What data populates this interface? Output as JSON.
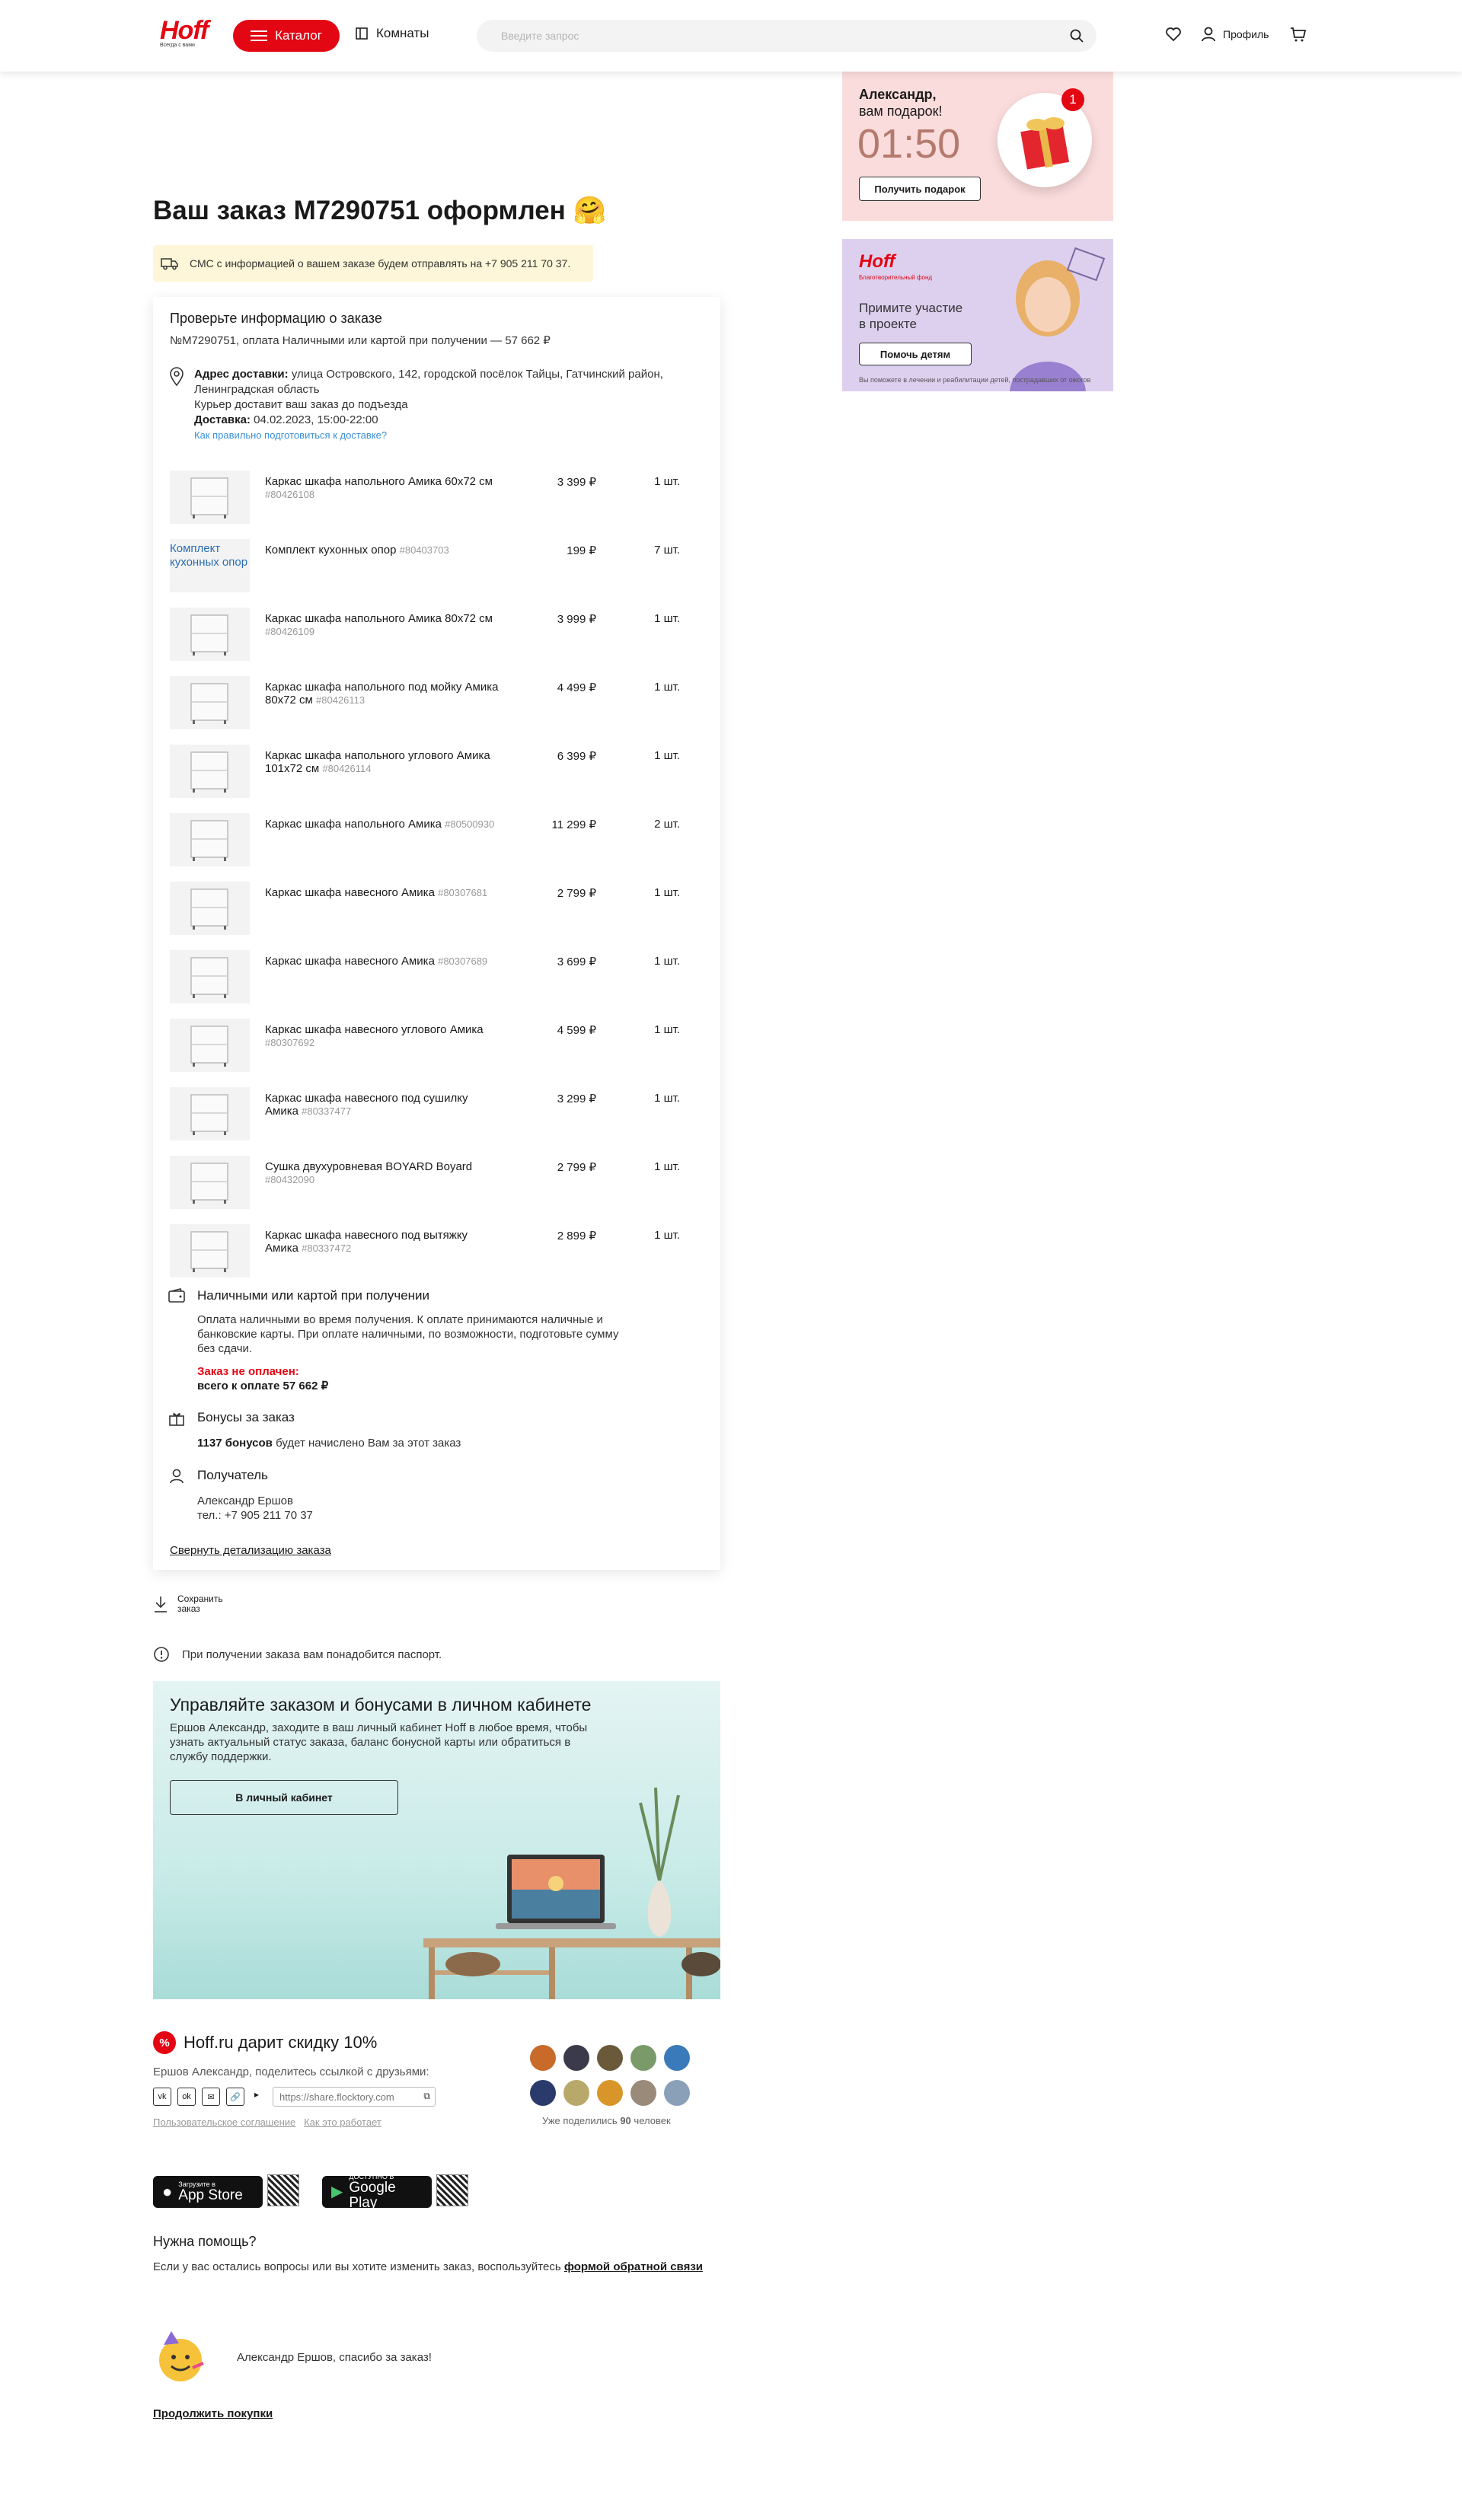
{
  "header": {
    "logo": "Hoff",
    "logo_sub": "Всегда с вами",
    "catalog": "Каталог",
    "rooms": "Комнаты",
    "search_placeholder": "Введите запрос",
    "profile": "Профиль"
  },
  "order": {
    "title": "Ваш заказ M7290751 оформлен 🤗",
    "sms": "СМС с информацией о вашем заказе будем отправлять на +7 905 211 70 37.",
    "check_title": "Проверьте информацию о заказе",
    "summary": "№M7290751, оплата Наличными или картой при получении — 57 662 ₽",
    "address_label": "Адрес доставки:",
    "address": "улица Островского, 142, городской посёлок Тайцы, Гатчинский район, Ленинградская область",
    "courier": "Курьер доставит ваш заказ до подъезда",
    "delivery_label": "Доставка:",
    "delivery_time": "04.02.2023, 15:00-22:00",
    "prep_link": "Как правильно подготовиться к доставке?",
    "items": [
      {
        "name": "Каркас шкафа напольного Амика 60x72 см",
        "code": "#80426108",
        "price": "3 399 ₽",
        "qty": "1 шт."
      },
      {
        "name": "Комплект кухонных опор",
        "code": "#80403703",
        "price": "199 ₽",
        "qty": "7 шт.",
        "thumb_text": "Комплект кухонных опор"
      },
      {
        "name": "Каркас шкафа напольного Амика 80x72 см",
        "code": "#80426109",
        "price": "3 999 ₽",
        "qty": "1 шт."
      },
      {
        "name": "Каркас шкафа напольного под мойку Амика 80x72 см",
        "code": "#80426113",
        "price": "4 499 ₽",
        "qty": "1 шт."
      },
      {
        "name": "Каркас шкафа напольного углового Амика 101x72 см",
        "code": "#80426114",
        "price": "6 399 ₽",
        "qty": "1 шт."
      },
      {
        "name": "Каркас шкафа напольного Амика",
        "code": "#80500930",
        "price": "11 299 ₽",
        "qty": "2 шт."
      },
      {
        "name": "Каркас шкафа навесного Амика",
        "code": "#80307681",
        "price": "2 799 ₽",
        "qty": "1 шт."
      },
      {
        "name": "Каркас шкафа навесного Амика",
        "code": "#80307689",
        "price": "3 699 ₽",
        "qty": "1 шт."
      },
      {
        "name": "Каркас шкафа навесного углового Амика",
        "code": "#80307692",
        "price": "4 599 ₽",
        "qty": "1 шт."
      },
      {
        "name": "Каркас шкафа навесного под сушилку Амика",
        "code": "#80337477",
        "price": "3 299 ₽",
        "qty": "1 шт."
      },
      {
        "name": "Сушка двухуровневая BOYARD Boyard",
        "code": "#80432090",
        "price": "2 799 ₽",
        "qty": "1 шт."
      },
      {
        "name": "Каркас шкафа навесного под вытяжку Амика",
        "code": "#80337472",
        "price": "2 899 ₽",
        "qty": "1 шт."
      }
    ],
    "payment_title": "Наличными или картой при получении",
    "payment_text": "Оплата наличными во время получения. К оплате принимаются наличные и банковские карты. При оплате наличными, по возможности, подготовьте сумму без сдачи.",
    "unpaid": "Заказ не оплачен:",
    "total": "всего к оплате 57 662 ₽",
    "bonus_title": "Бонусы за заказ",
    "bonus_count": "1137 бонусов",
    "bonus_text": "будет начислено Вам за этот заказ",
    "recipient_title": "Получатель",
    "recipient_name": "Александр Ершов",
    "recipient_phone": "тел.: +7 905 211 70 37",
    "collapse": "Свернуть детализацию заказа"
  },
  "save": "Сохранить заказ",
  "passport": "При получении заказа вам понадобится паспорт.",
  "cabinet": {
    "title": "Управляйте заказом и бонусами в личном кабинете",
    "text": "Ершов Александр, заходите в ваш личный кабинет Hoff в любое время, чтобы узнать актуальный статус заказа, баланс бонусной карты или обратиться в службу поддержки.",
    "button": "В личный кабинет"
  },
  "share": {
    "title": "Hoff.ru дарит скидку 10%",
    "pct": "%",
    "text": "Ершов Александр, поделитесь ссылкой с друзьями:",
    "link": "https://share.flocktory.com",
    "agreement": "Пользовательское соглашение",
    "how": "Как это работает",
    "shared_prefix": "Уже поделились",
    "shared_count": "90",
    "shared_suffix": "человек"
  },
  "stores": {
    "apple_small": "Загрузите в",
    "apple": "App Store",
    "google_small": "ДОСТУПНО В",
    "google": "Google Play"
  },
  "help": {
    "title": "Нужна помощь?",
    "text": "Если у вас остались вопросы или вы хотите изменить заказ, воспользуйтесь",
    "link": "формой обратной связи"
  },
  "thanks": "Александр Ершов, спасибо за заказ!",
  "continue": "Продолжить покупки",
  "gift_banner": {
    "name": "Александр,",
    "sub": "вам подарок!",
    "timer": "01:50",
    "button": "Получить подарок",
    "badge": "1"
  },
  "charity_banner": {
    "logo": "Hoff",
    "fund": "Благотворительный фонд",
    "text1": "Примите участие",
    "text2": "в проекте",
    "button": "Помочь детям",
    "footer": "Вы поможете в лечении и реабилитации детей, пострадавших от ожогов"
  },
  "colors": {
    "brand": "#e30613",
    "link": "#3a8fd6"
  }
}
